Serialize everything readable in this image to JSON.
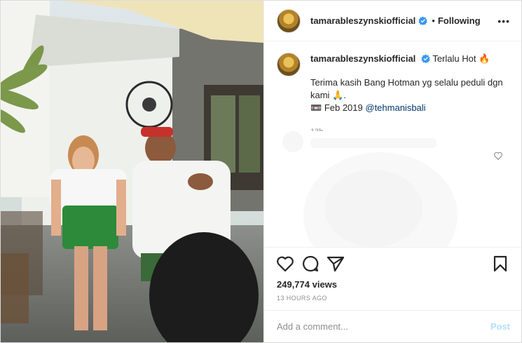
{
  "post": {
    "username": "tamarableszynskiofficial",
    "follow_status": "Following",
    "more_label": "•••",
    "separator": "•"
  },
  "caption": {
    "username": "tamarableszynskiofficial",
    "line1_text": "Terlalu Hot",
    "line1_emoji": "🔥",
    "body_text": "Terima kasih Bang Hotman yg selalu peduli dgn kami 🙏.",
    "date_emoji": "📼",
    "date_text": "Feb 2019",
    "mention": "@tehmanisbali",
    "relative_time": "13h"
  },
  "stats": {
    "views": "249,774 views",
    "time_ago": "13 HOURS AGO"
  },
  "comment_input": {
    "placeholder": "Add a comment...",
    "post_label": "Post"
  },
  "icons": {
    "verified": "verified-badge-icon",
    "like": "heart-icon",
    "comment": "comment-icon",
    "share": "share-icon",
    "save": "bookmark-icon",
    "caption_like": "heart-icon"
  },
  "colors": {
    "verified_blue": "#3897f0",
    "post_disabled": "#b2dffc",
    "mention": "#00376b",
    "muted": "#8e8e8e"
  }
}
